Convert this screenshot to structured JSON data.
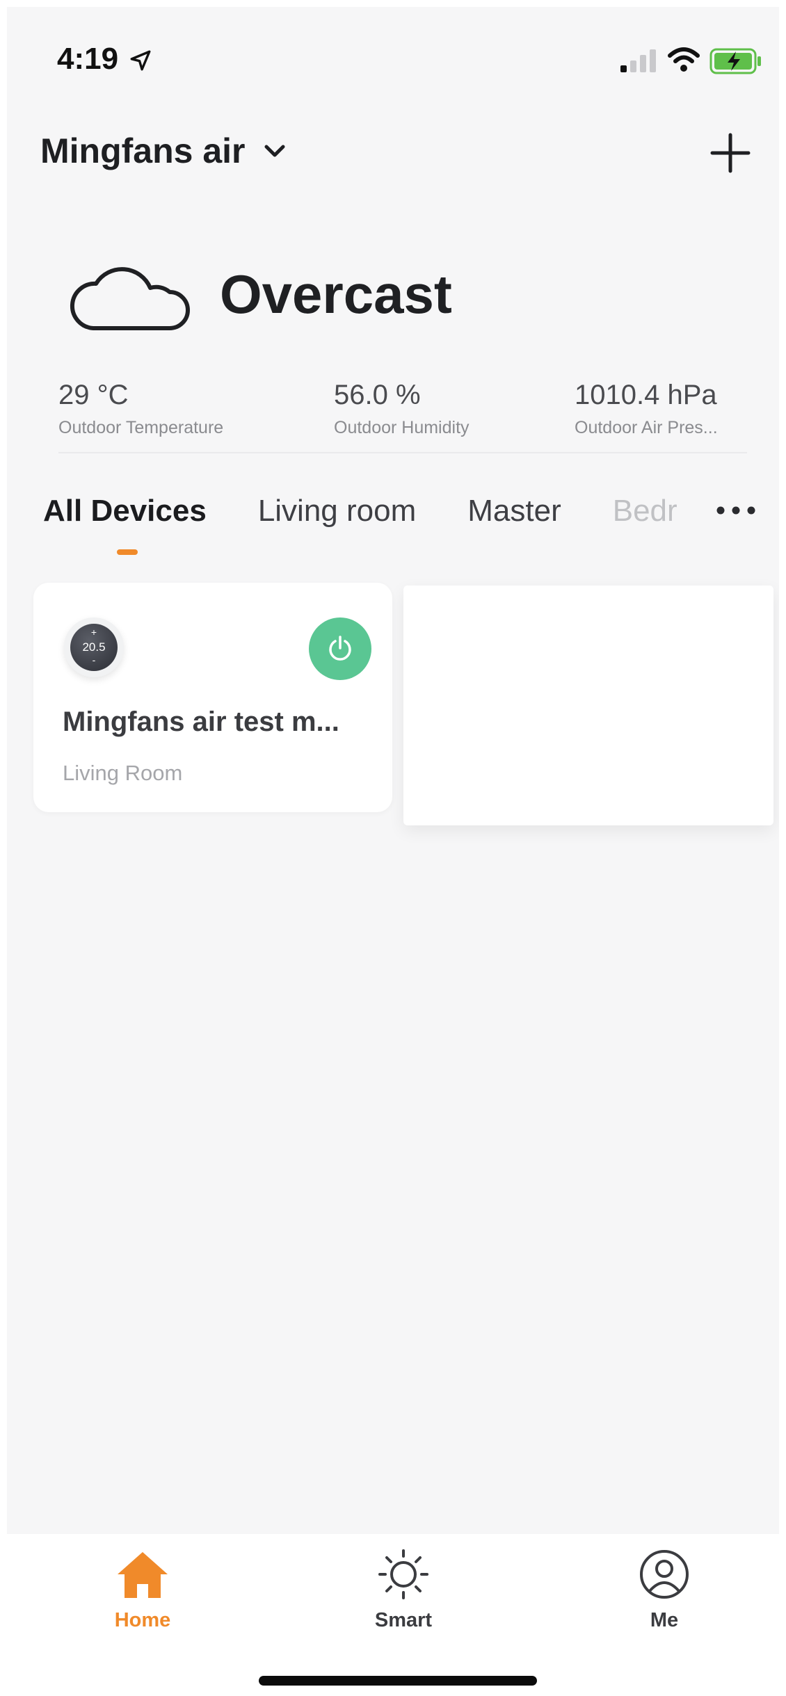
{
  "status_bar": {
    "time": "4:19",
    "icons": [
      "location-arrow-icon",
      "signal-icon",
      "wifi-icon",
      "battery-charging-icon"
    ]
  },
  "header": {
    "home_name": "Mingfans air",
    "dropdown_icon": "chevron-down-icon",
    "add_icon": "plus-icon"
  },
  "weather": {
    "icon": "cloud-icon",
    "condition": "Overcast",
    "metrics": [
      {
        "value": "29 °C",
        "label": "Outdoor Temperature"
      },
      {
        "value": "56.0 %",
        "label": "Outdoor Humidity"
      },
      {
        "value": "1010.4 hPa",
        "label": "Outdoor Air Pres..."
      }
    ]
  },
  "tabs": {
    "items": [
      "All Devices",
      "Living room",
      "Master",
      "Bedr"
    ],
    "active": "All Devices",
    "more_icon": "more-dots-icon"
  },
  "devices": [
    {
      "name": "Mingfans air test m...",
      "room": "Living Room",
      "thermostat_value": "20.5",
      "thermostat_plus": "+",
      "thermostat_minus": "-",
      "power_on": true,
      "accent_color": "#5ac693"
    }
  ],
  "bottom_nav": {
    "items": [
      {
        "label": "Home",
        "icon": "home-icon",
        "active": true
      },
      {
        "label": "Smart",
        "icon": "sun-icon",
        "active": false
      },
      {
        "label": "Me",
        "icon": "user-circle-icon",
        "active": false
      }
    ],
    "accent_color": "#f08a2a"
  }
}
